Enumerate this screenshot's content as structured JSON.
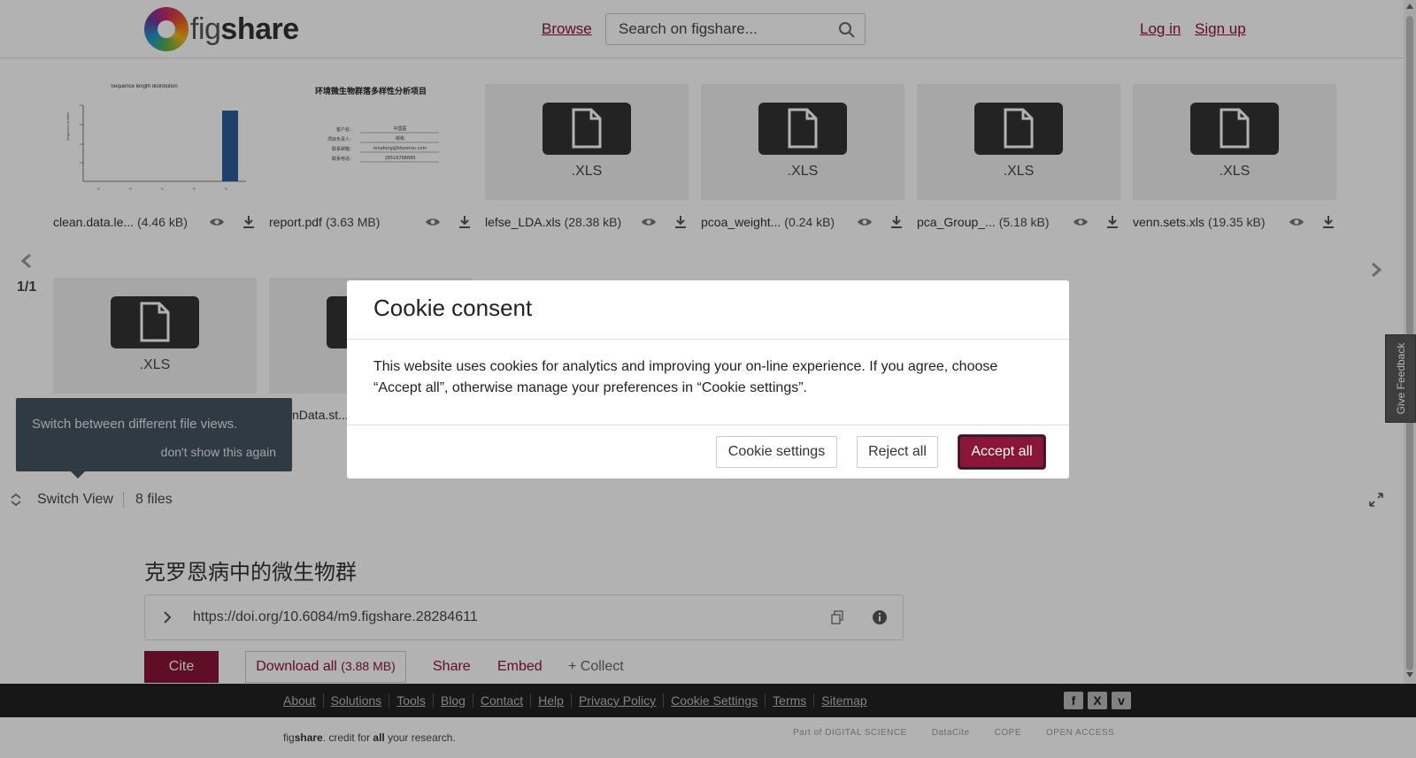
{
  "header": {
    "logo_text_light": "fig",
    "logo_text_bold": "share",
    "browse_label": "Browse",
    "search_placeholder": "Search on figshare...",
    "login_label": "Log in",
    "signup_label": "Sign up"
  },
  "files_row1": [
    {
      "name": "clean.data.le...",
      "size": "(4.46 kB)",
      "type": "preview-chart"
    },
    {
      "name": "report.pdf",
      "size": "(3.63 MB)",
      "type": "preview-doc"
    },
    {
      "name": "lefse_LDA.xls",
      "size": "(28.38 kB)",
      "ext": ".XLS"
    },
    {
      "name": "pcoa_weight...",
      "size": "(0.24 kB)",
      "ext": ".XLS"
    },
    {
      "name": "pca_Group_...",
      "size": "(5.18 kB)",
      "ext": ".XLS"
    },
    {
      "name": "venn.sets.xls",
      "size": "(19.35 kB)",
      "ext": ".XLS"
    }
  ],
  "files_row2": [
    {
      "name": "",
      "size": "",
      "ext": ".XLS"
    },
    {
      "name": "nData.st...",
      "size": "",
      "ext": ""
    }
  ],
  "preview_report": {
    "title": "环境微生物群落多样性分析项目",
    "rows": [
      "客户名：",
      "项目负责人：",
      "联系邮箱：",
      "联系电话："
    ],
    "values": [
      "中国医",
      "缪栋",
      "miudong@biozeron.com",
      "18516768689"
    ]
  },
  "preview_chart": {
    "title": "Sequence length distribution",
    "ylabel": "Sequence number"
  },
  "pagination": {
    "label": "1/1"
  },
  "tooltip": {
    "text": "Switch between different file views.",
    "dismiss": "don't show this again"
  },
  "toolbar": {
    "switch_label": "Switch View",
    "files_count": "8 files"
  },
  "item": {
    "title": "克罗恩病中的微生物群",
    "doi": "https://doi.org/10.6084/m9.figshare.28284611",
    "cite_label": "Cite",
    "download_label": "Download all",
    "download_size": "(3.88 MB)",
    "share_label": "Share",
    "embed_label": "Embed",
    "collect_label": "+ Collect"
  },
  "feedback": {
    "label": "Give Feedback"
  },
  "footer": {
    "links": [
      "About",
      "Solutions",
      "Tools",
      "Blog",
      "Contact",
      "Help",
      "Privacy Policy",
      "Cookie Settings",
      "Terms",
      "Sitemap"
    ],
    "tagline_pre": "fig",
    "tagline_bold1": "share",
    "tagline_mid": ". credit for ",
    "tagline_bold2": "all",
    "tagline_post": " your research.",
    "partners": [
      "Part of DIGITAL SCIENCE",
      "DataCite",
      "COPE",
      "OPEN ACCESS"
    ]
  },
  "cookie": {
    "title": "Cookie consent",
    "body": "This website uses cookies for analytics and improving your on-line experience. If you agree, choose “Accept all”, otherwise manage your preferences in “Cookie settings”.",
    "settings_label": "Cookie settings",
    "reject_label": "Reject all",
    "accept_label": "Accept all"
  },
  "colors": {
    "accent": "#8a1538",
    "tooltip_bg": "#465460",
    "footer_bg": "#222222"
  }
}
